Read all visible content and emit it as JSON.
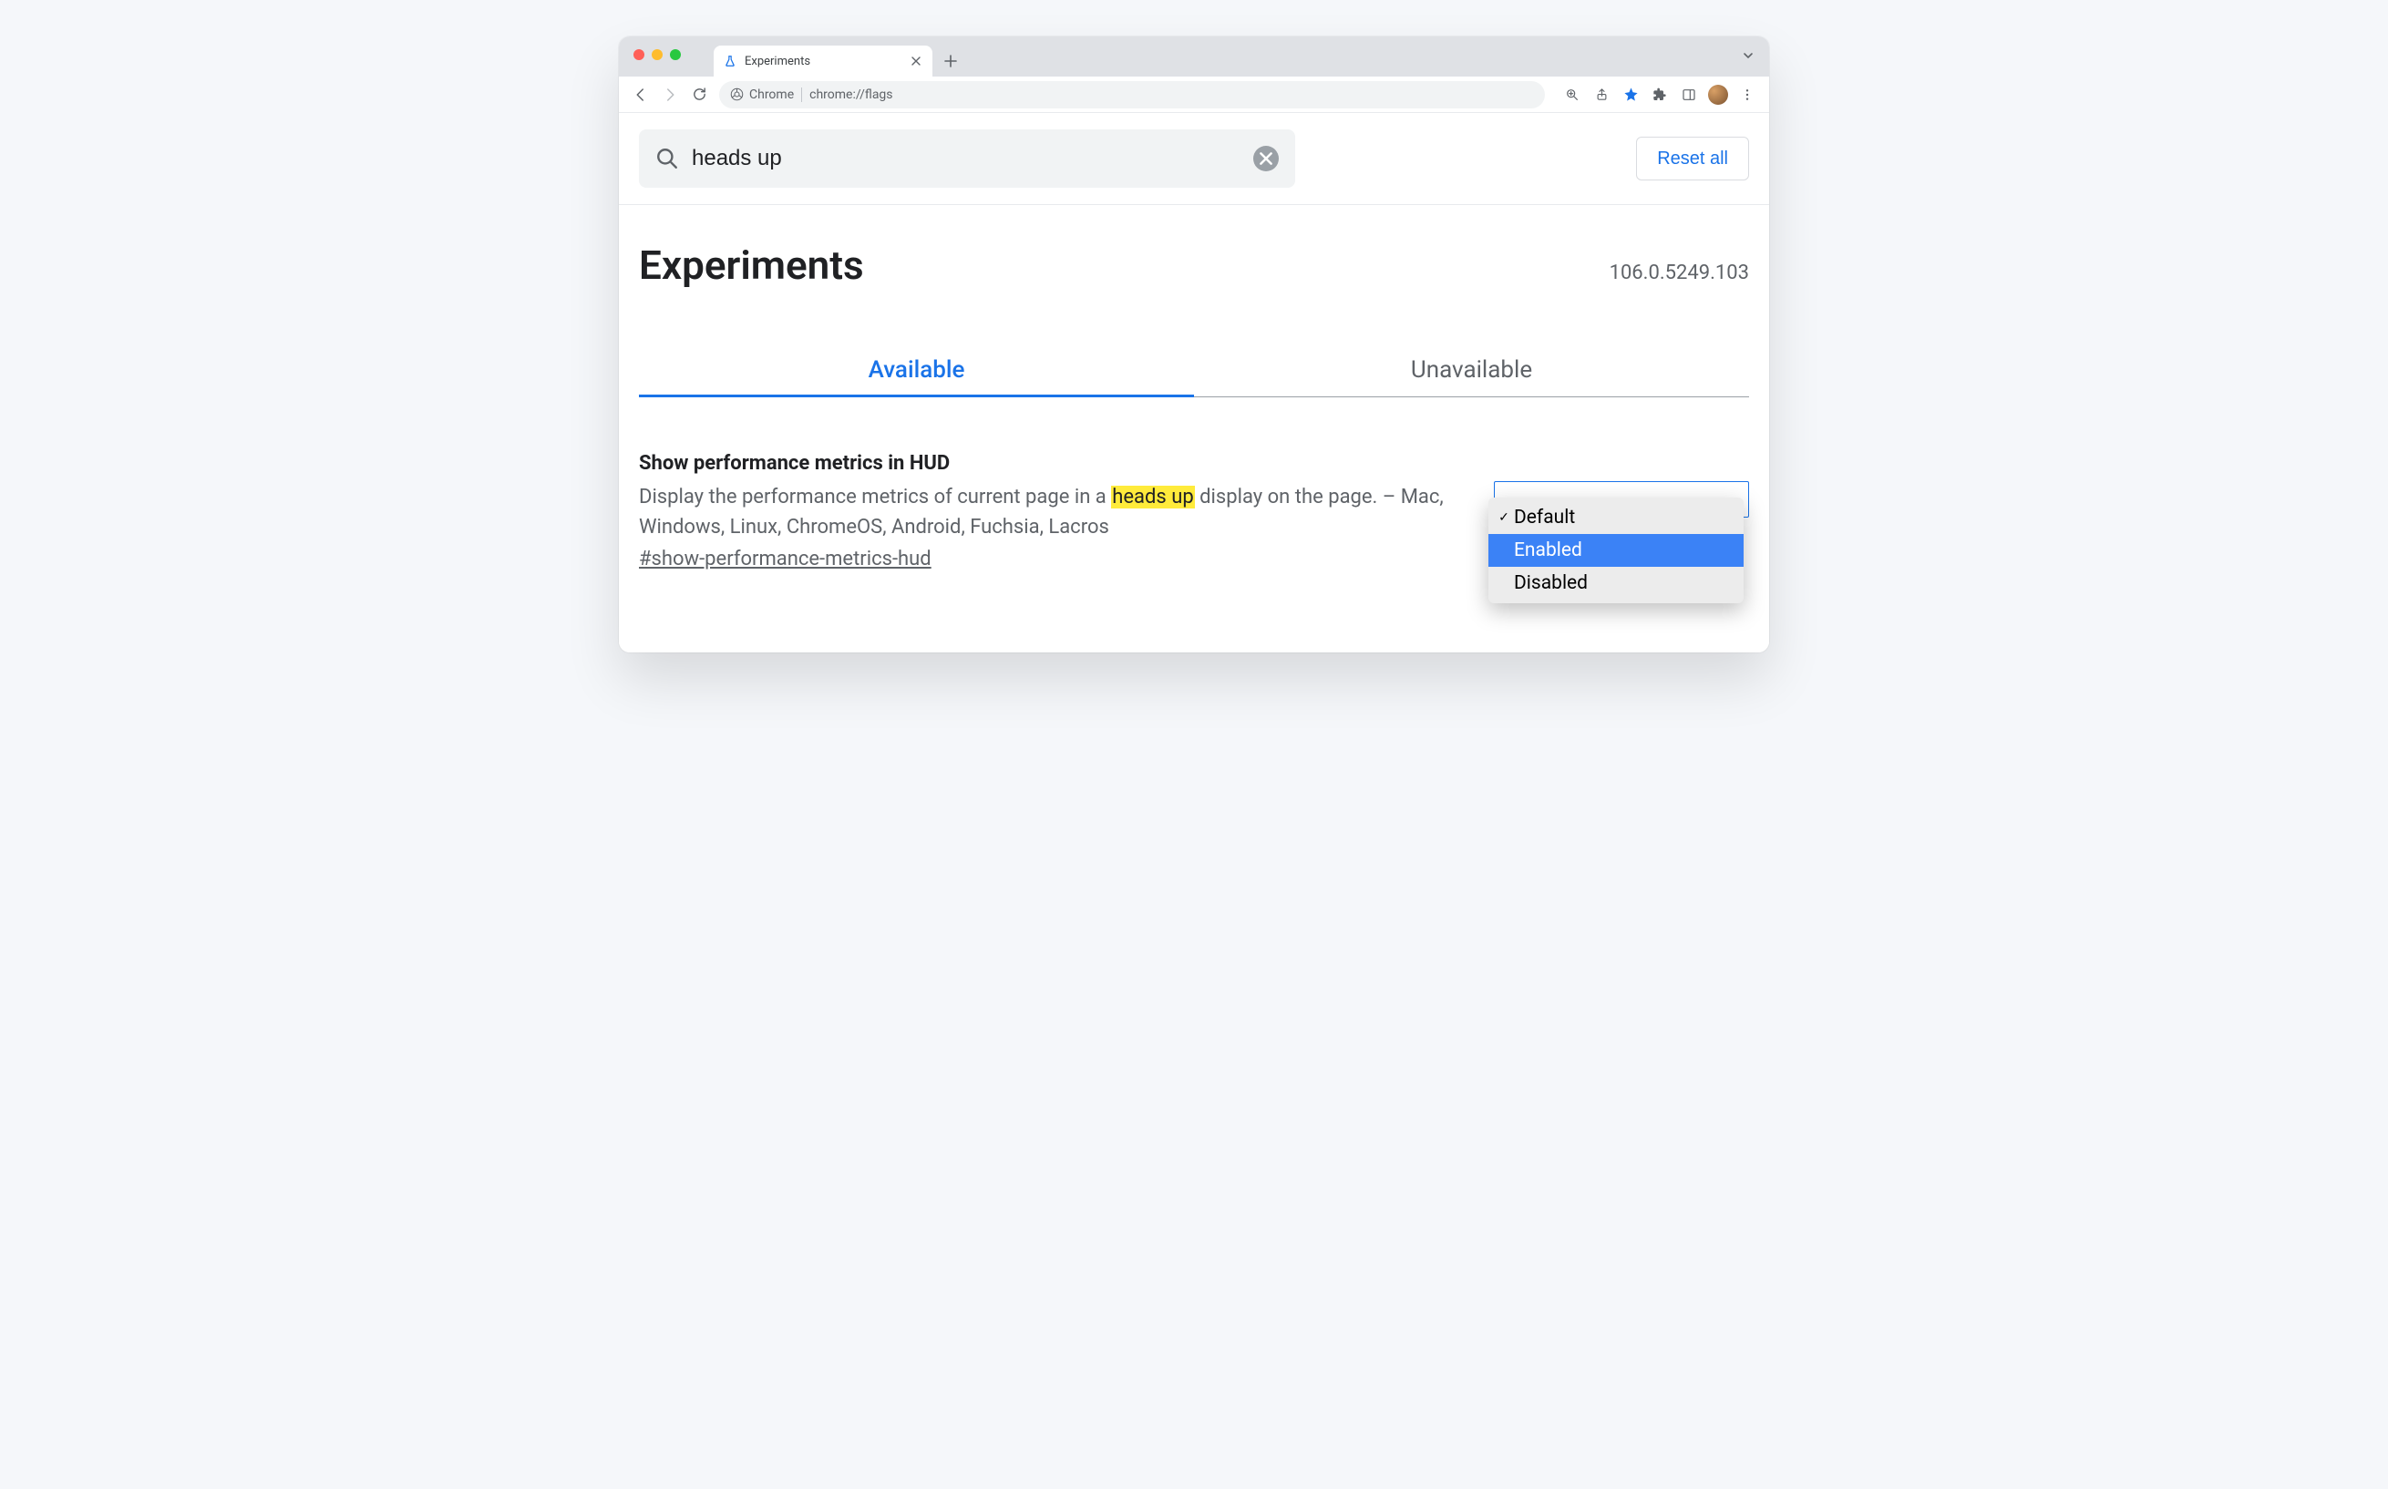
{
  "browser": {
    "tab_title": "Experiments",
    "omnibox_chip": "Chrome",
    "url": "chrome://flags"
  },
  "search": {
    "value": "heads up"
  },
  "reset_label": "Reset all",
  "page_title": "Experiments",
  "version": "106.0.5249.103",
  "tabs": {
    "available": "Available",
    "unavailable": "Unavailable"
  },
  "flag": {
    "title": "Show performance metrics in HUD",
    "desc_pre": "Display the performance metrics of current page in a ",
    "desc_hl": "heads up",
    "desc_post": " display on the page. – Mac, Windows, Linux, ChromeOS, Android, Fuchsia, Lacros",
    "hash": "#show-performance-metrics-hud",
    "options": {
      "default": "Default",
      "enabled": "Enabled",
      "disabled": "Disabled"
    }
  }
}
